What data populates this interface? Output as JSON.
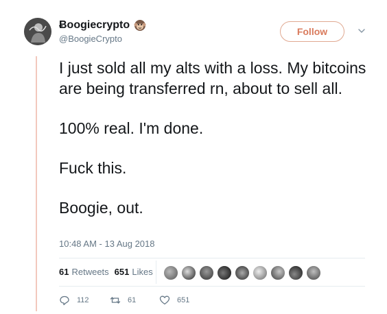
{
  "user": {
    "display_name": "Ƀoogiecrypto",
    "handle": "@BoogieCrypto",
    "badge_icon": "monkey-face-icon",
    "avatar_icon": "profile-photo"
  },
  "follow_button_label": "Follow",
  "menu_icon": "chevron-down-icon",
  "tweet": {
    "paragraphs": [
      "I just sold all my alts with a loss. My bitcoins are being transferred rn, about to sell all.",
      "100% real. I'm done.",
      "Fuck this.",
      "Boogie, out."
    ],
    "timestamp": "10:48 AM - 13 Aug 2018"
  },
  "stats": {
    "retweets_count": "61",
    "retweets_label": "Retweets",
    "likes_count": "651",
    "likes_label": "Likes",
    "liker_avatar_count": 9
  },
  "actions": {
    "reply_count": "112",
    "retweet_count": "61",
    "like_count": "651"
  },
  "colors": {
    "accent": "#d97a5c",
    "thread_line": "#f2c8bd",
    "secondary_text": "#657786"
  }
}
